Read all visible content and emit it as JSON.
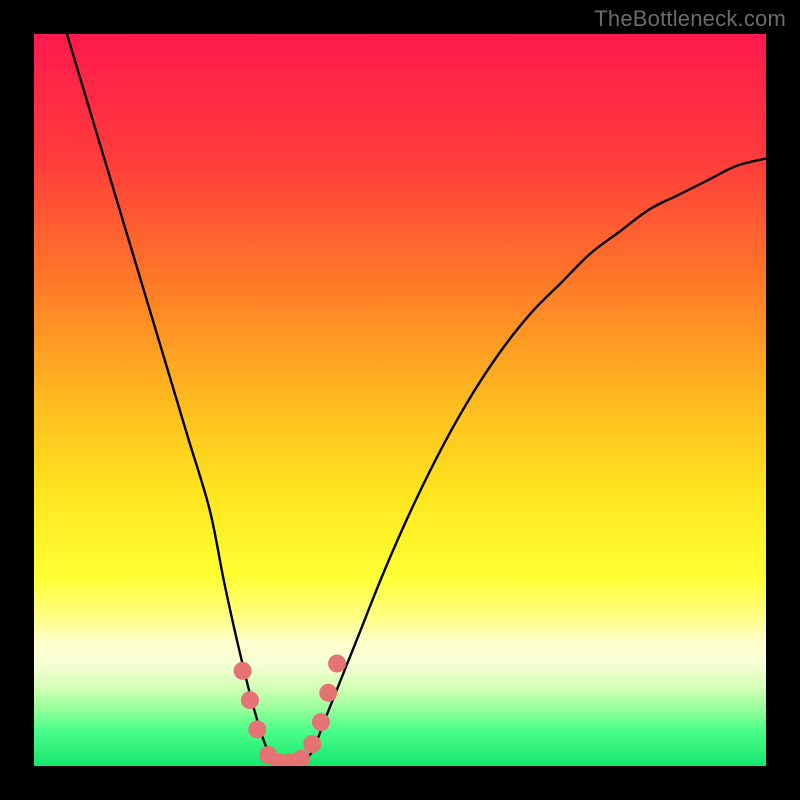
{
  "watermark": "TheBottleneck.com",
  "chart_data": {
    "type": "line",
    "title": "",
    "xlabel": "",
    "ylabel": "",
    "xlim": [
      0,
      100
    ],
    "ylim": [
      0,
      100
    ],
    "gradient_stops": [
      {
        "offset": 0,
        "color": "#ff1a4d"
      },
      {
        "offset": 17,
        "color": "#ff3b3b"
      },
      {
        "offset": 34,
        "color": "#ff7a28"
      },
      {
        "offset": 50,
        "color": "#ffba1f"
      },
      {
        "offset": 63,
        "color": "#ffe61f"
      },
      {
        "offset": 74,
        "color": "#ffff33"
      },
      {
        "offset": 80,
        "color": "#ffff8a"
      },
      {
        "offset": 83,
        "color": "#ffffcc"
      },
      {
        "offset": 86,
        "color": "#f6ffd6"
      },
      {
        "offset": 89,
        "color": "#d8ffb8"
      },
      {
        "offset": 92,
        "color": "#9cff9c"
      },
      {
        "offset": 95,
        "color": "#4dff8a"
      },
      {
        "offset": 100,
        "color": "#16e66e"
      }
    ],
    "series": [
      {
        "name": "bottleneck-curve",
        "x": [
          0,
          3,
          6,
          9,
          12,
          15,
          18,
          21,
          24,
          26,
          28,
          30,
          32,
          34,
          36,
          38,
          40,
          44,
          48,
          52,
          56,
          60,
          64,
          68,
          72,
          76,
          80,
          84,
          88,
          92,
          96,
          100
        ],
        "y": [
          115,
          105,
          95,
          85,
          75,
          65,
          55,
          45,
          35,
          25,
          16,
          8,
          2,
          0,
          0,
          2,
          7,
          17,
          27,
          36,
          44,
          51,
          57,
          62,
          66,
          70,
          73,
          76,
          78,
          80,
          82,
          83
        ]
      }
    ],
    "markers": {
      "name": "highlighted-points",
      "color": "#e57373",
      "points": [
        {
          "x": 28.5,
          "y": 13
        },
        {
          "x": 29.5,
          "y": 9
        },
        {
          "x": 30.5,
          "y": 5
        },
        {
          "x": 32.0,
          "y": 1.5
        },
        {
          "x": 33.5,
          "y": 0.5
        },
        {
          "x": 35.0,
          "y": 0.5
        },
        {
          "x": 36.5,
          "y": 1.0
        },
        {
          "x": 38.0,
          "y": 3.0
        },
        {
          "x": 39.2,
          "y": 6.0
        },
        {
          "x": 40.2,
          "y": 10.0
        },
        {
          "x": 41.4,
          "y": 14.0
        }
      ]
    }
  }
}
